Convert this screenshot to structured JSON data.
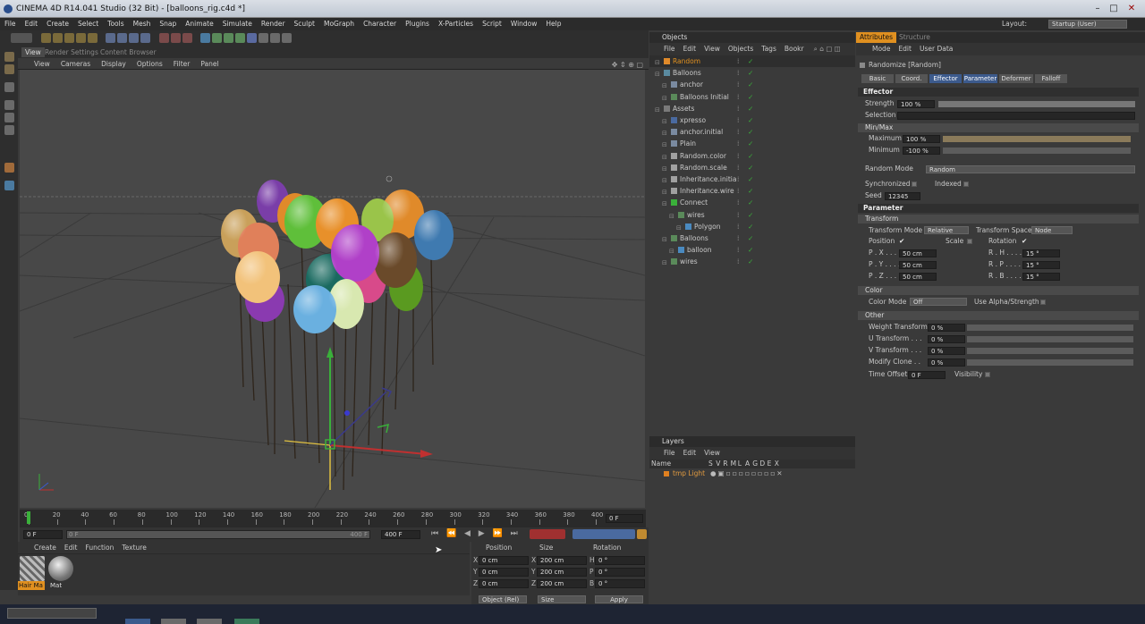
{
  "window": {
    "title": "CINEMA 4D R14.041 Studio (32 Bit) - [balloons_rig.c4d *]"
  },
  "menu": [
    "File",
    "Edit",
    "Create",
    "Select",
    "Tools",
    "Mesh",
    "Snap",
    "Animate",
    "Simulate",
    "Render",
    "Sculpt",
    "MoGraph",
    "Character",
    "Plugins",
    "X-Particles",
    "Script",
    "Window",
    "Help"
  ],
  "layout": {
    "label": "Layout:",
    "value": "Startup (User)"
  },
  "viewport": {
    "tabs": [
      "View",
      "Render Settings",
      "Content Browser"
    ],
    "menu": [
      "View",
      "Cameras",
      "Display",
      "Options",
      "Filter",
      "Panel"
    ]
  },
  "timeline": {
    "ticks": [
      "0",
      "20",
      "40",
      "60",
      "80",
      "100",
      "120",
      "140",
      "160",
      "180",
      "200",
      "220",
      "240",
      "260",
      "280",
      "300",
      "320",
      "340",
      "360",
      "380",
      "400"
    ],
    "current": "0 F",
    "start": "0 F",
    "min": "0 F",
    "max": "400 F",
    "end": "400 F"
  },
  "material_manager": {
    "menu": [
      "Create",
      "Edit",
      "Function",
      "Texture"
    ],
    "materials": [
      "Hair Ma",
      "Mat"
    ]
  },
  "coords": {
    "headers": [
      "Position",
      "Size",
      "Rotation"
    ],
    "rows": [
      {
        "axis": "X",
        "pos": "0 cm",
        "size": "200 cm",
        "rot_axis": "H",
        "rot": "0 °"
      },
      {
        "axis": "Y",
        "pos": "0 cm",
        "size": "200 cm",
        "rot_axis": "P",
        "rot": "0 °"
      },
      {
        "axis": "Z",
        "pos": "0 cm",
        "size": "200 cm",
        "rot_axis": "B",
        "rot": "0 °"
      }
    ],
    "mode": "Object (Rel)",
    "size_mode": "Size",
    "apply": "Apply"
  },
  "objects": {
    "title": "Objects",
    "menu": [
      "File",
      "Edit",
      "View",
      "Objects",
      "Tags",
      "Bookr"
    ],
    "items": [
      {
        "name": "Random",
        "indent": 0,
        "sel": true
      },
      {
        "name": "Balloons",
        "indent": 0
      },
      {
        "name": "anchor",
        "indent": 1
      },
      {
        "name": "Balloons Initial",
        "indent": 1
      },
      {
        "name": "Assets",
        "indent": 0
      },
      {
        "name": "xpresso",
        "indent": 1
      },
      {
        "name": "anchor.initial",
        "indent": 1
      },
      {
        "name": "Plain",
        "indent": 1
      },
      {
        "name": "Random.color",
        "indent": 1
      },
      {
        "name": "Random.scale",
        "indent": 1
      },
      {
        "name": "Inheritance.initia",
        "indent": 1
      },
      {
        "name": "Inheritance.wire",
        "indent": 1
      },
      {
        "name": "Connect",
        "indent": 1
      },
      {
        "name": "wires",
        "indent": 2
      },
      {
        "name": "Polygon",
        "indent": 3
      },
      {
        "name": "Balloons",
        "indent": 1
      },
      {
        "name": "balloon",
        "indent": 2
      },
      {
        "name": "wires",
        "indent": 1
      }
    ]
  },
  "layers": {
    "title": "Layers",
    "menu": [
      "File",
      "Edit",
      "View"
    ],
    "columns": [
      "Name",
      "S",
      "V",
      "R",
      "M",
      "L",
      "A",
      "G",
      "D",
      "E",
      "X"
    ],
    "items": [
      {
        "name": "tmp Light"
      }
    ]
  },
  "attributes": {
    "tabs": [
      "Attributes",
      "Structure"
    ],
    "menu": [
      "Mode",
      "Edit",
      "User Data"
    ],
    "object": "Randomize [Random]",
    "subtabs": [
      "Basic",
      "Coord.",
      "Effector",
      "Parameter",
      "Deformer",
      "Falloff"
    ],
    "effector": "Effector",
    "strength_label": "Strength",
    "strength": "100 %",
    "selection_label": "Selection",
    "minmax": "Min/Max",
    "maximum_label": "Maximum",
    "maximum": "100 %",
    "minimum_label": "Minimum",
    "minimum": "-100 %",
    "random_mode_label": "Random Mode",
    "random_mode": "Random",
    "synchronized": "Synchronized",
    "indexed": "Indexed",
    "seed_label": "Seed",
    "seed": "12345",
    "parameter": "Parameter",
    "transform": "Transform",
    "transform_mode_label": "Transform Mode",
    "transform_mode": "Relative",
    "transform_space_label": "Transform Space",
    "transform_space": "Node",
    "position": "Position",
    "scale": "Scale",
    "rotation": "Rotation",
    "p_rows": [
      {
        "label": "P . X . . . .",
        "value": "50 cm",
        "rlabel": "R . H . . . .",
        "rvalue": "15 °"
      },
      {
        "label": "P . Y . . . .",
        "value": "50 cm",
        "rlabel": "R . P . . . .",
        "rvalue": "15 °"
      },
      {
        "label": "P . Z . . . .",
        "value": "50 cm",
        "rlabel": "R . B . . . .",
        "rvalue": "15 °"
      }
    ],
    "color": "Color",
    "color_mode_label": "Color Mode",
    "color_mode": "Off",
    "use_alpha": "Use Alpha/Strength",
    "other": "Other",
    "other_rows": [
      {
        "label": "Weight Transform",
        "value": "0 %"
      },
      {
        "label": "U Transform . . .",
        "value": "0 %"
      },
      {
        "label": "V Transform . . .",
        "value": "0 %"
      },
      {
        "label": "Modify Clone . .",
        "value": "0 %"
      }
    ],
    "time_offset_label": "Time Offset",
    "time_offset": "0 F",
    "visibility": "Visibility"
  }
}
